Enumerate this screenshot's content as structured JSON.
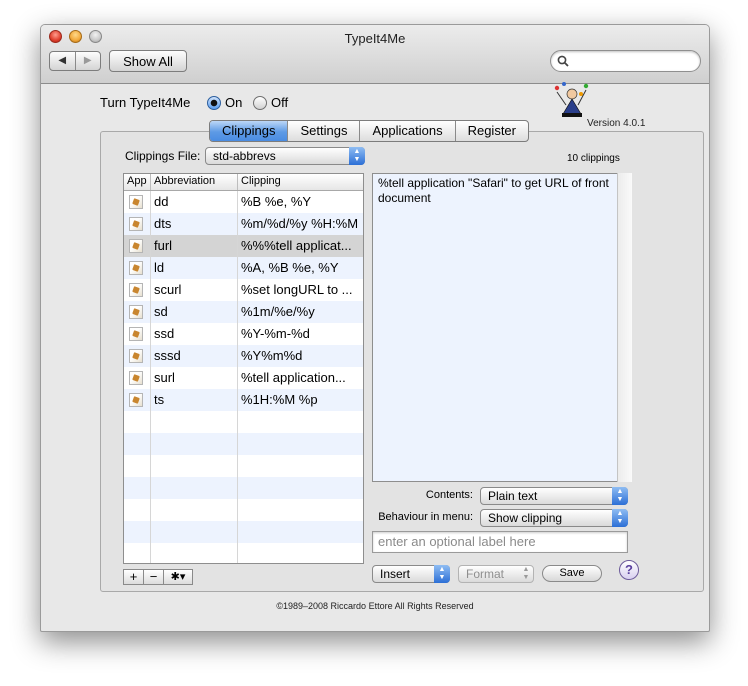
{
  "window": {
    "title": "TypeIt4Me"
  },
  "toolbar": {
    "back_label": "◀",
    "forward_label": "▶",
    "show_all_label": "Show All",
    "search_placeholder": ""
  },
  "toggle": {
    "label": "Turn TypeIt4Me",
    "on_label": "On",
    "off_label": "Off",
    "selected": "On"
  },
  "version": "Version 4.0.1",
  "tabs": [
    {
      "label": "Clippings",
      "active": true
    },
    {
      "label": "Settings",
      "active": false
    },
    {
      "label": "Applications",
      "active": false
    },
    {
      "label": "Register",
      "active": false
    }
  ],
  "clippings_file": {
    "label": "Clippings File:",
    "value": "std-abbrevs"
  },
  "clip_count": "10 clippings",
  "table": {
    "headers": [
      "App",
      "Abbreviation",
      "Clipping"
    ],
    "rows": [
      {
        "abbr": "dd",
        "clip": "%B %e, %Y"
      },
      {
        "abbr": "dts",
        "clip": "%m/%d/%y %H:%M"
      },
      {
        "abbr": "furl",
        "clip": "%%%tell applicat..."
      },
      {
        "abbr": "ld",
        "clip": "%A, %B %e, %Y"
      },
      {
        "abbr": "scurl",
        "clip": "%set longURL to ..."
      },
      {
        "abbr": "sd",
        "clip": "%1m/%e/%y"
      },
      {
        "abbr": "ssd",
        "clip": "%Y-%m-%d"
      },
      {
        "abbr": "sssd",
        "clip": "%Y%m%d"
      },
      {
        "abbr": "surl",
        "clip": "%tell application..."
      },
      {
        "abbr": "ts",
        "clip": "%1H:%M %p"
      }
    ],
    "selected_index": 2
  },
  "editor": {
    "text": "%tell application \"Safari\" to get URL of front document"
  },
  "contents": {
    "label": "Contents:",
    "value": "Plain text"
  },
  "behaviour": {
    "label": "Behaviour in menu:",
    "value": "Show clipping"
  },
  "label_field": {
    "placeholder": "enter an optional label here"
  },
  "buttons": {
    "insert": "Insert",
    "format": "Format",
    "save": "Save",
    "help": "?",
    "add": "+",
    "remove": "−",
    "action": "✱▾"
  },
  "copyright": "©1989–2008 Riccardo Ettore All Rights Reserved",
  "colors": {
    "accent": "#4a8ce2",
    "row_stripe": "#edf3fe",
    "selected_row": "#d4d4d4"
  }
}
